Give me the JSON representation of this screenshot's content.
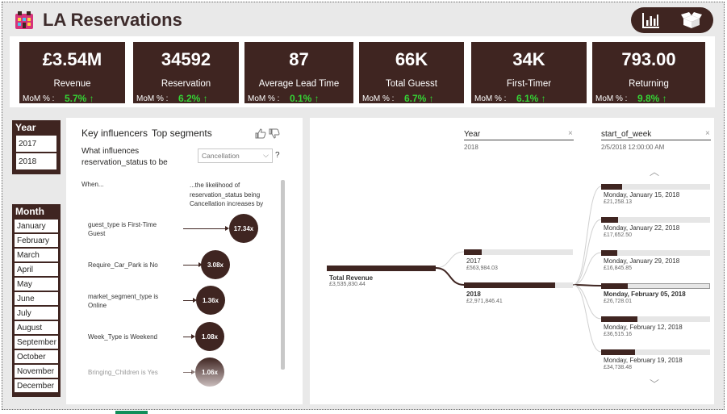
{
  "header": {
    "title": "LA Reservations",
    "nav": {
      "chart_icon": "bar-chart-icon",
      "box_icon": "open-box-icon"
    }
  },
  "kpis": [
    {
      "value": "£3.54M",
      "label": "Revenue",
      "mom_label": "MoM % :",
      "delta": "5.7% ↑"
    },
    {
      "value": "34592",
      "label": "Reservation",
      "mom_label": "MoM % :",
      "delta": "6.2% ↑"
    },
    {
      "value": "87",
      "label": "Average Lead Time",
      "mom_label": "MoM % :",
      "delta": "0.1% ↑"
    },
    {
      "value": "66K",
      "label": "Total Guesst",
      "mom_label": "MoM % :",
      "delta": "6.7% ↑"
    },
    {
      "value": "34K",
      "label": "First-Timer",
      "mom_label": "MoM % :",
      "delta": "6.1% ↑"
    },
    {
      "value": "793.00",
      "label": "Returning",
      "mom_label": "MoM % :",
      "delta": "9.8% ↑"
    }
  ],
  "slicers": {
    "year": {
      "title": "Year",
      "items": [
        "2017",
        "2018"
      ]
    },
    "month": {
      "title": "Month",
      "items": [
        "January",
        "February",
        "March",
        "April",
        "May",
        "June",
        "July",
        "August",
        "September",
        "October",
        "November",
        "December"
      ]
    }
  },
  "key_influencers": {
    "tab_influencers": "Key influencers",
    "tab_segments": "Top segments",
    "question_line1": "What influences",
    "question_line2": "reservation_status to be",
    "select_value": "Cancellation",
    "help": "?",
    "when": "When...",
    "likelihood_line1": "...the likelihood of",
    "likelihood_line2": "reservation_status being",
    "likelihood_line3": "Cancellation increases by",
    "rows": [
      {
        "label": "guest_type is First-Time Guest",
        "factor": "17.34x"
      },
      {
        "label": "Require_Car_Park is No",
        "factor": "3.08x"
      },
      {
        "label": "market_segment_type is Online",
        "factor": "1.36x"
      },
      {
        "label": "Week_Type is Weekend",
        "factor": "1.08x"
      },
      {
        "label": "Bringing_Children is Yes",
        "factor": "1.06x"
      }
    ]
  },
  "decomp_tree": {
    "col_year": {
      "header": "Year",
      "sub": "2018"
    },
    "col_week": {
      "header": "start_of_week",
      "sub": "2/5/2018 12:00:00 AM"
    },
    "close": "×",
    "root": {
      "label": "Total Revenue",
      "value": "£3,535,830.44"
    },
    "years": [
      {
        "label": "2017",
        "value": "£563,984.03",
        "share": 0.16
      },
      {
        "label": "2018",
        "value": "£2,971,846.41",
        "share": 0.84
      }
    ],
    "weeks": [
      {
        "label": "Monday, January 15, 2018",
        "value": "£21,258.13",
        "share": 0.58
      },
      {
        "label": "Monday, January 22, 2018",
        "value": "£17,652.50",
        "share": 0.48
      },
      {
        "label": "Monday, January 29, 2018",
        "value": "£16,845.85",
        "share": 0.46
      },
      {
        "label": "Monday, February 05, 2018",
        "value": "£26,728.01",
        "share": 0.73
      },
      {
        "label": "Monday, February 12, 2018",
        "value": "£36,515.16",
        "share": 1.0
      },
      {
        "label": "Monday, February 19, 2018",
        "value": "£34,738.48",
        "share": 0.95
      }
    ]
  },
  "colors": {
    "brand": "#3f2521",
    "positive": "#35d435",
    "panel": "#ffffff",
    "background": "#e9e9e9"
  }
}
